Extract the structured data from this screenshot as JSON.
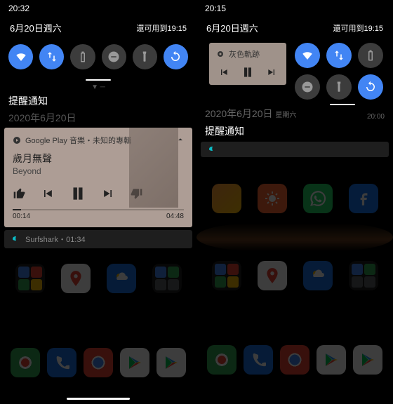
{
  "left": {
    "time": "20:32",
    "date": "6月20日週六",
    "battery_text": "還可用到19:15",
    "ghost_date": "2020年6月20日",
    "notif_header": "提醒通知",
    "media": {
      "app_line": "Google Play 音樂・未知的專輯",
      "song": "歲月無聲",
      "artist": "Beyond",
      "elapsed": "00:14",
      "total": "04:48",
      "progress_pct": 5
    },
    "small_notif_text": "Surfshark・01:34"
  },
  "right": {
    "time": "20:15",
    "date": "6月20日週六",
    "battery_text": "還可用到19:15",
    "mini_title": "灰色軌跡",
    "ghost_date": "2020年6月20日",
    "ghost_day": "星期六",
    "ghost_time": "20:00",
    "notif_header": "提醒通知"
  },
  "qs_tiles": {
    "wifi": {
      "icon": "wifi",
      "active": true
    },
    "data": {
      "icon": "swap",
      "active": true
    },
    "battery": {
      "icon": "battery",
      "active": false
    },
    "dnd": {
      "icon": "dnd",
      "active": false
    },
    "flash": {
      "icon": "flash",
      "active": false
    },
    "rotate": {
      "icon": "rotate",
      "active": true
    }
  },
  "dock": [
    "mail",
    "phone",
    "chrome",
    "play",
    "play"
  ]
}
